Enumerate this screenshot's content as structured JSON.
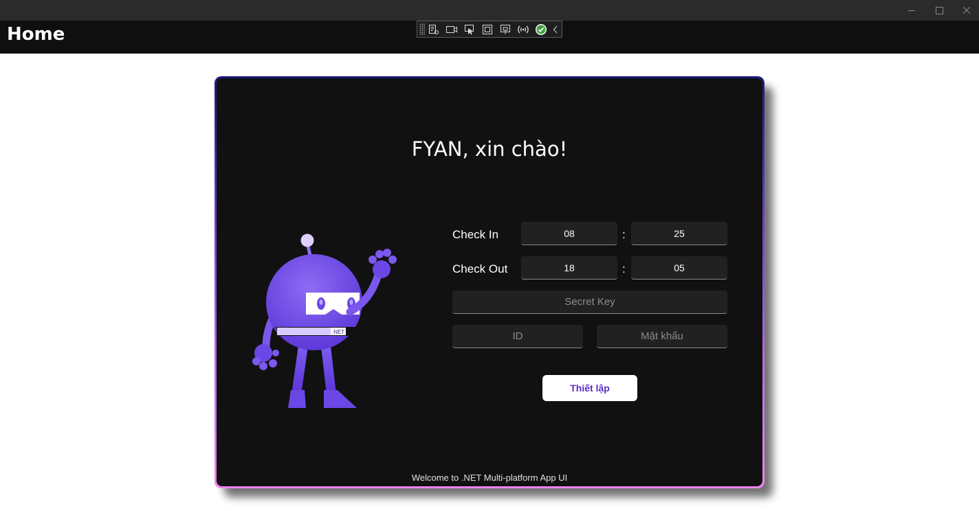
{
  "window": {
    "controls": [
      "minimize",
      "maximize",
      "close"
    ]
  },
  "header": {
    "title": "Home"
  },
  "debug_toolbar": {
    "icons": [
      "live-visual-tree-icon",
      "record-icon",
      "select-element-icon",
      "display-layout-adorners-icon",
      "track-focus-icon",
      "hot-reload-icon",
      "check-icon",
      "collapse-chevron-icon"
    ]
  },
  "card": {
    "greeting": "FYAN, xin chào!",
    "check_in": {
      "label": "Check In",
      "hour": "08",
      "minute": "25"
    },
    "check_out": {
      "label": "Check Out",
      "hour": "18",
      "minute": "05"
    },
    "separator": ":",
    "secret_key_placeholder": "Secret Key",
    "id_placeholder": "ID",
    "password_placeholder": "Mật khẩu",
    "submit_label": "Thiết lập",
    "bot_badge": ".NET",
    "footer": "Welcome to .NET Multi-platform App UI"
  },
  "colors": {
    "accent": "#5b2bc4",
    "card_bg": "#111111",
    "border_top": "#1d1a7c",
    "border_bottom": "#ee84ee",
    "bot_purple": "#6b47e6"
  }
}
